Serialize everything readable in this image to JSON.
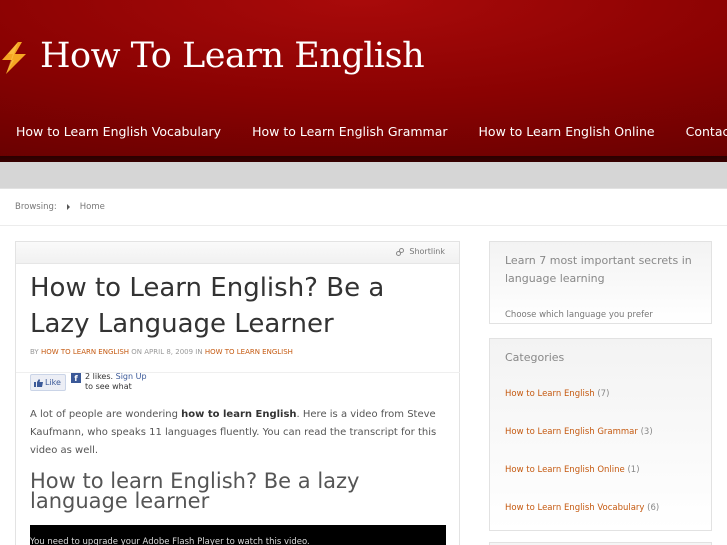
{
  "site": {
    "title": "How To Learn English",
    "brand_color": "#8a0202"
  },
  "nav": {
    "items": [
      {
        "label": "How to Learn English Vocabulary"
      },
      {
        "label": "How to Learn English Grammar"
      },
      {
        "label": "How to Learn English Online"
      },
      {
        "label": "Contact Us"
      }
    ]
  },
  "breadcrumb": {
    "label": "Browsing:",
    "home": "Home"
  },
  "post": {
    "shortlink": "Shortlink",
    "title": "How to Learn English? Be a Lazy Language Learner",
    "byline": {
      "by": "BY",
      "author": "HOW TO LEARN ENGLISH",
      "on": "ON APRIL 8, 2009 IN",
      "category": "HOW TO LEARN ENGLISH"
    },
    "like": {
      "button": "Like",
      "count_text": "2 likes.",
      "signup": "Sign Up",
      "signup_suffix": "to see what"
    },
    "body_before": "A lot of people are wondering ",
    "body_bold": "how to learn English",
    "body_after": ". Here is a video from Steve Kaufmann, who speaks 11 languages fluently. You can read the transcript for this video as well.",
    "subheading": "How to learn English? Be a lazy language learner",
    "video_notice": "You need to upgrade your Adobe Flash Player to watch this video."
  },
  "sidebar": {
    "promo": {
      "heading": "Learn 7 most important secrets in language learning",
      "sub": "Choose which language you prefer"
    },
    "categories": {
      "heading": "Categories",
      "items": [
        {
          "label": "How to Learn English",
          "count": "(7)"
        },
        {
          "label": "How to Learn English Grammar",
          "count": "(3)"
        },
        {
          "label": "How to Learn English Online",
          "count": "(1)"
        },
        {
          "label": "How to Learn English Vocabulary",
          "count": "(6)"
        }
      ]
    }
  },
  "colors": {
    "link": "#c55a11",
    "facebook": "#3b5998"
  }
}
